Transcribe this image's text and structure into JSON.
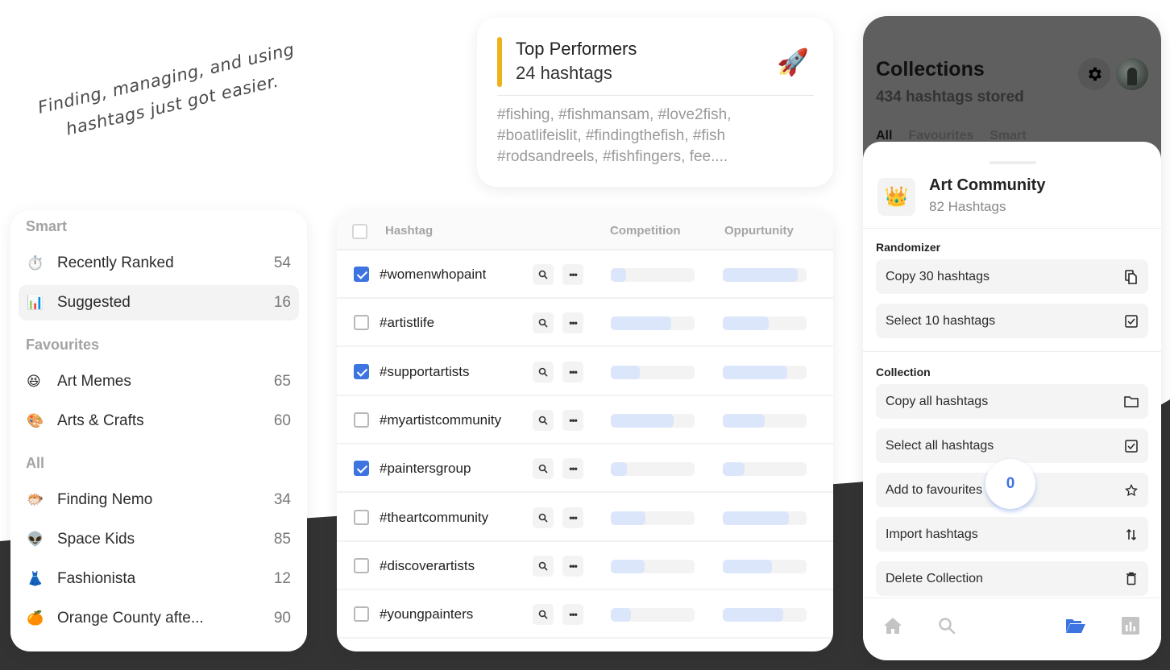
{
  "colors": {
    "accent_blue": "#3D74E0",
    "accent_yellow": "#EDB21A",
    "bar_fill": "#DCE6FB",
    "bar_track": "#F3F3F3",
    "dark_background": "#333333"
  },
  "tagline": "Finding, managing, and using hashtags just got easier.",
  "top_performers": {
    "title": "Top Performers",
    "count": "24 hashtags",
    "emoji": "🚀",
    "tags_preview": "#fishing, #fishmansam, #love2fish, #boatlifeislit, #findingthefish, #fish #rodsandreels, #fishfingers, fee...."
  },
  "sidebar": {
    "sections": [
      {
        "title": "Smart",
        "items": [
          {
            "icon": "⏱️",
            "icon_name": "stopwatch-icon",
            "label": "Recently Ranked",
            "count": "54",
            "active": false
          },
          {
            "icon": "📊",
            "icon_name": "bar-chart-icon",
            "label": "Suggested",
            "count": "16",
            "active": true
          }
        ]
      },
      {
        "title": "Favourites",
        "items": [
          {
            "icon": "😆",
            "icon_name": "laughing-face-icon",
            "label": "Art Memes",
            "count": "65",
            "active": false
          },
          {
            "icon": "🎨",
            "icon_name": "palette-icon",
            "label": "Arts & Crafts",
            "count": "60",
            "active": false
          }
        ]
      },
      {
        "title": "All",
        "items": [
          {
            "icon": "🐡",
            "icon_name": "blowfish-icon",
            "label": "Finding Nemo",
            "count": "34",
            "active": false
          },
          {
            "icon": "👽",
            "icon_name": "alien-icon",
            "label": "Space Kids",
            "count": "85",
            "active": false
          },
          {
            "icon": "👗",
            "icon_name": "dress-icon",
            "label": "Fashionista",
            "count": "12",
            "active": false
          },
          {
            "icon": "🍊",
            "icon_name": "orange-icon",
            "label": "Orange County afte...",
            "count": "90",
            "active": false
          }
        ]
      }
    ]
  },
  "table": {
    "columns": {
      "hashtag": "Hashtag",
      "competition": "Competition",
      "opportunity": "Oppurtunity"
    },
    "header_checked": false,
    "rows": [
      {
        "tag": "#womenwhopaint",
        "checked": true,
        "competition": 0.18,
        "opportunity": 0.89
      },
      {
        "tag": "#artistlife",
        "checked": false,
        "competition": 0.72,
        "opportunity": 0.55
      },
      {
        "tag": "#supportartists",
        "checked": true,
        "competition": 0.35,
        "opportunity": 0.77
      },
      {
        "tag": "#myartistcommunity",
        "checked": false,
        "competition": 0.75,
        "opportunity": 0.5
      },
      {
        "tag": "#paintersgroup",
        "checked": true,
        "competition": 0.19,
        "opportunity": 0.26
      },
      {
        "tag": "#theartcommunity",
        "checked": false,
        "competition": 0.41,
        "opportunity": 0.79
      },
      {
        "tag": "#discoverartists",
        "checked": false,
        "competition": 0.4,
        "opportunity": 0.59
      },
      {
        "tag": "#youngpainters",
        "checked": false,
        "competition": 0.24,
        "opportunity": 0.72
      }
    ]
  },
  "phone": {
    "title": "Collections",
    "subtitle": "434 hashtags stored",
    "tabs": [
      {
        "label": "All",
        "active": true
      },
      {
        "label": "Favourites",
        "active": false
      },
      {
        "label": "Smart",
        "active": false
      }
    ],
    "sheet": {
      "collection_icon": "👑",
      "collection_name": "Art Community",
      "collection_count": "82 Hashtags",
      "randomizer_title": "Randomizer",
      "randomizer_actions": [
        {
          "label": "Copy 30 hashtags",
          "icon": "copy-icon"
        },
        {
          "label": "Select 10 hashtags",
          "icon": "checkbox-icon"
        }
      ],
      "collection_title": "Collection",
      "collection_actions": [
        {
          "label": "Copy all hashtags",
          "icon": "folder-icon"
        },
        {
          "label": "Select all hashtags",
          "icon": "checkbox-icon"
        },
        {
          "label": "Add to favourites",
          "icon": "star-icon"
        },
        {
          "label": "Import hashtags",
          "icon": "sort-arrows-icon"
        },
        {
          "label": "Delete Collection",
          "icon": "trash-icon"
        }
      ]
    },
    "fab_count": "0",
    "tabbar": [
      {
        "icon": "home-icon",
        "active": false
      },
      {
        "icon": "search-icon",
        "active": false
      },
      {
        "icon": "folder-open-icon",
        "active": true
      },
      {
        "icon": "stats-icon",
        "active": false
      }
    ]
  }
}
